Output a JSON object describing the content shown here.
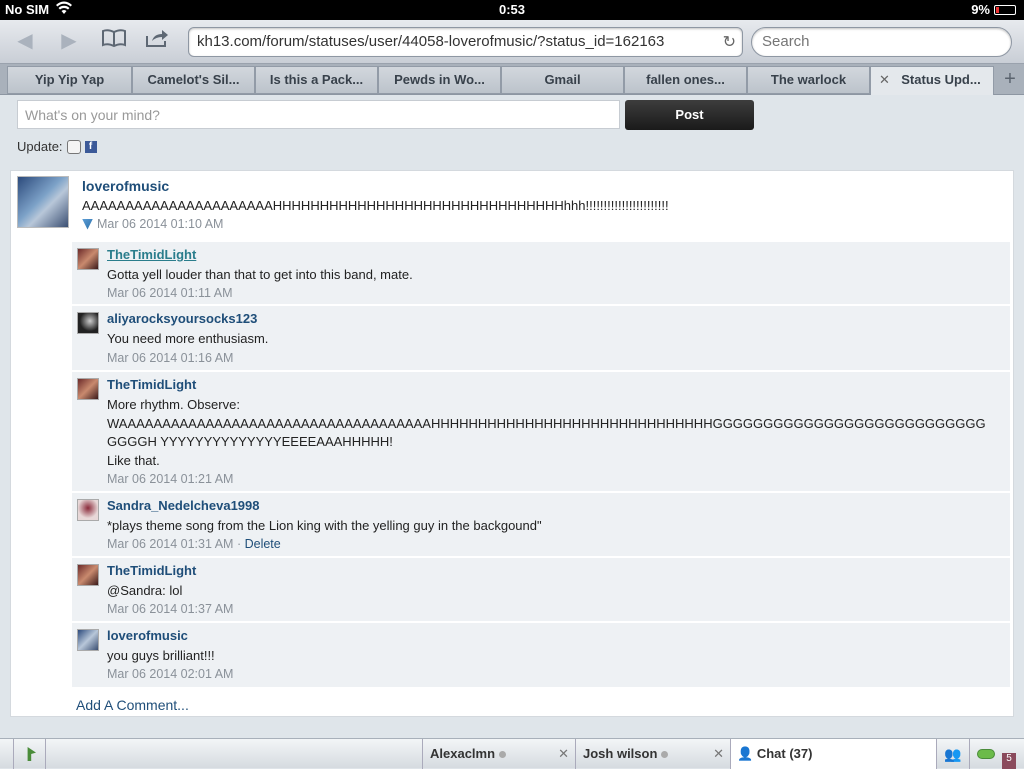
{
  "status_bar": {
    "carrier": "No SIM",
    "time": "0:53",
    "battery": "9%"
  },
  "browser": {
    "url": "kh13.com/forum/statuses/user/44058-loverofmusic/?status_id=162163",
    "search_placeholder": "Search",
    "tabs": [
      {
        "label": "Yip Yip Yap"
      },
      {
        "label": "Camelot's Sil..."
      },
      {
        "label": "Is this a Pack..."
      },
      {
        "label": "Pewds in Wo..."
      },
      {
        "label": "Gmail"
      },
      {
        "label": "fallen ones..."
      },
      {
        "label": "The warlock"
      },
      {
        "label": "Status Upd..."
      }
    ]
  },
  "composer": {
    "placeholder": "What's on your mind?",
    "post_label": "Post",
    "update_label": "Update:",
    "fb_glyph": "f"
  },
  "status": {
    "author": "loverofmusic",
    "text": "AAAAAAAAAAAAAAAAAAAAAAHHHHHHHHHHHHHHHHHHHHHHHHHHHHHHHhhh!!!!!!!!!!!!!!!!!!!!!!!",
    "timestamp": "Mar 06 2014 01:10 AM"
  },
  "comments": [
    {
      "author": "TheTimidLight",
      "text": "Gotta yell louder than that to get into this band, mate.",
      "timestamp": "Mar 06 2014 01:11 AM"
    },
    {
      "author": "aliyarocksyoursocks123",
      "text": "You need more enthusiasm.",
      "timestamp": "Mar 06 2014 01:16 AM"
    },
    {
      "author": "TheTimidLight",
      "text_lines": [
        "More rhythm. Observe:",
        "WAAAAAAAAAAAAAAAAAAAAAAAAAAAAAAAAAAAAHHHHHHHHHHHHHHHHHHHHHHHHHHHHHHGGGGGGGGGGGGGGGGGGGGGGGGGGG",
        "GGGGH YYYYYYYYYYYYYYEEEEAAAHHHHH!",
        "Like that."
      ],
      "timestamp": "Mar 06 2014 01:21 AM"
    },
    {
      "author": "Sandra_Nedelcheva1998",
      "text": "*plays theme song from the Lion king with the yelling guy in the backgound\"",
      "timestamp": "Mar 06 2014 01:31 AM",
      "separator": " · ",
      "delete_label": "Delete"
    },
    {
      "author": "TheTimidLight",
      "text": "@Sandra: lol",
      "timestamp": "Mar 06 2014 01:37 AM"
    },
    {
      "author": "loverofmusic",
      "text": "you guys brilliant!!!",
      "timestamp": "Mar 06 2014 02:01 AM"
    }
  ],
  "add_comment_label": "Add A Comment...",
  "chat_bar": {
    "tabs": [
      {
        "name": "Alexaclmn"
      },
      {
        "name": "Josh wilson"
      }
    ],
    "chat_label": "Chat",
    "chat_count": "(37)",
    "badge": "5"
  },
  "colors": {
    "link": "#1f4e79",
    "meta": "#8a9199",
    "online": "#4a8c3a"
  }
}
